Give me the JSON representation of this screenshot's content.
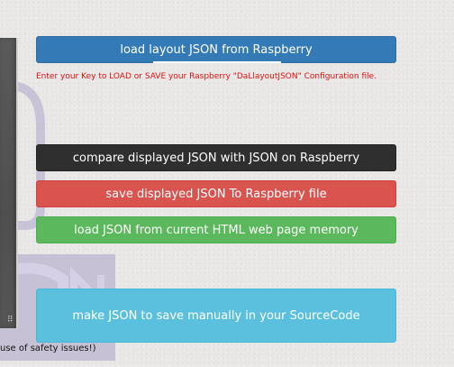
{
  "buttons": {
    "load_layout": "load layout JSON from Raspberry",
    "compare": "compare displayed JSON with JSON on Raspberry",
    "save": "save displayed JSON To Raspberry file",
    "load_memory": "load JSON from current HTML web page memory",
    "make_json": "make JSON to save manually in your SourceCode"
  },
  "hint": "Enter your Key to LOAD or SAVE your Raspberry \"DaLlayoutJSON\" Configuration file.",
  "caption_fragment": "use of safety issues!)",
  "colors": {
    "primary": "#337ab7",
    "dark": "#2f2f2f",
    "danger": "#d9534f",
    "success": "#5cb85c",
    "info": "#5bc0de",
    "hint_text": "#e01010"
  }
}
